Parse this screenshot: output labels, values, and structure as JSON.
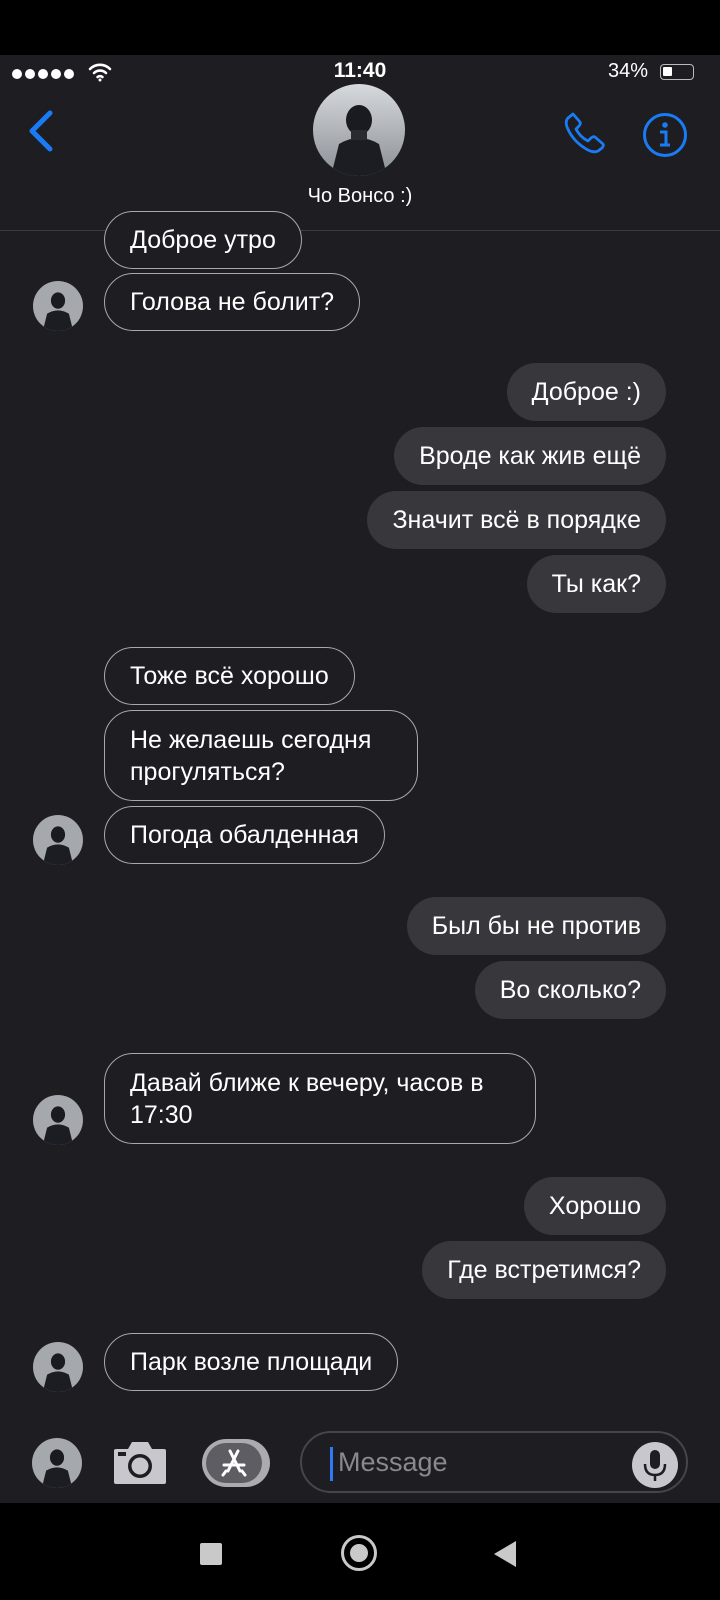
{
  "status_bar": {
    "time": "11:40",
    "battery": "34%",
    "battery_level": 0.34
  },
  "header": {
    "contact_name": "Чо Вонсо  :)"
  },
  "messages": [
    {
      "dir": "in",
      "text": "Доброе утро"
    },
    {
      "dir": "in",
      "text": "Голова не болит?"
    },
    {
      "dir": "out",
      "text": "Доброе :)"
    },
    {
      "dir": "out",
      "text": "Вроде как жив ещё"
    },
    {
      "dir": "out",
      "text": "Значит всё в порядке"
    },
    {
      "dir": "out",
      "text": "Ты как?"
    },
    {
      "dir": "in",
      "text": "Тоже всё хорошо"
    },
    {
      "dir": "in",
      "text": "Не желаешь сегодня прогуляться?"
    },
    {
      "dir": "in",
      "text": "Погода обалденная"
    },
    {
      "dir": "out",
      "text": "Был бы не против"
    },
    {
      "dir": "out",
      "text": "Во сколько?"
    },
    {
      "dir": "in",
      "text": "Давай ближе к вечеру, часов в 17:30"
    },
    {
      "dir": "out",
      "text": "Хорошо"
    },
    {
      "dir": "out",
      "text": "Где встретимся?"
    },
    {
      "dir": "in",
      "text": "Парк возле площади"
    }
  ],
  "input": {
    "placeholder": "Message",
    "value": ""
  },
  "icons": {
    "back": "chevron-left-icon",
    "call": "phone-icon",
    "info": "info-icon",
    "camera": "camera-icon",
    "apps": "app-store-icon",
    "mic": "microphone-icon"
  },
  "colors": {
    "accent": "#1a7cf5",
    "background": "#1e1d21",
    "outgoing_bubble": "#38373c"
  }
}
